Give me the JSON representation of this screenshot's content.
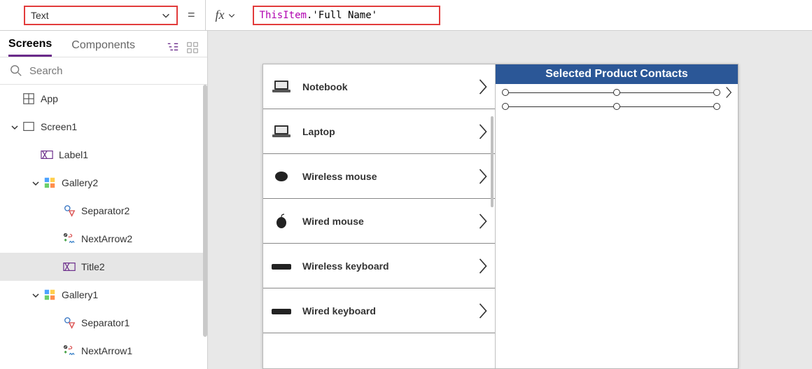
{
  "formula_bar": {
    "property": "Text",
    "formula_this": "ThisItem",
    "formula_prop": ".'Full Name'"
  },
  "tree": {
    "tabs": {
      "screens": "Screens",
      "components": "Components"
    },
    "search_placeholder": "Search",
    "items": [
      {
        "label": "App",
        "indent": 0,
        "icon": "app",
        "caret": false,
        "selected": false
      },
      {
        "label": "Screen1",
        "indent": 1,
        "icon": "screen",
        "caret": true,
        "selected": false
      },
      {
        "label": "Label1",
        "indent": 2,
        "icon": "label",
        "caret": false,
        "selected": false
      },
      {
        "label": "Gallery2",
        "indent": 3,
        "icon": "gallery",
        "caret": true,
        "selected": false
      },
      {
        "label": "Separator2",
        "indent": 4,
        "icon": "separator",
        "caret": false,
        "selected": false
      },
      {
        "label": "NextArrow2",
        "indent": 4,
        "icon": "nextarrow",
        "caret": false,
        "selected": false
      },
      {
        "label": "Title2",
        "indent": 4,
        "icon": "label",
        "caret": false,
        "selected": true
      },
      {
        "label": "Gallery1",
        "indent": 3,
        "icon": "gallery",
        "caret": true,
        "selected": false
      },
      {
        "label": "Separator1",
        "indent": 4,
        "icon": "separator",
        "caret": false,
        "selected": false
      },
      {
        "label": "NextArrow1",
        "indent": 4,
        "icon": "nextarrow",
        "caret": false,
        "selected": false
      }
    ]
  },
  "canvas": {
    "contacts_header": "Selected Product Contacts",
    "products": [
      {
        "name": "Notebook",
        "thumb": "laptop"
      },
      {
        "name": "Laptop",
        "thumb": "laptop"
      },
      {
        "name": "Wireless mouse",
        "thumb": "mouse"
      },
      {
        "name": "Wired mouse",
        "thumb": "mouse-wired"
      },
      {
        "name": "Wireless keyboard",
        "thumb": "keyboard"
      },
      {
        "name": "Wired keyboard",
        "thumb": "keyboard"
      }
    ]
  }
}
